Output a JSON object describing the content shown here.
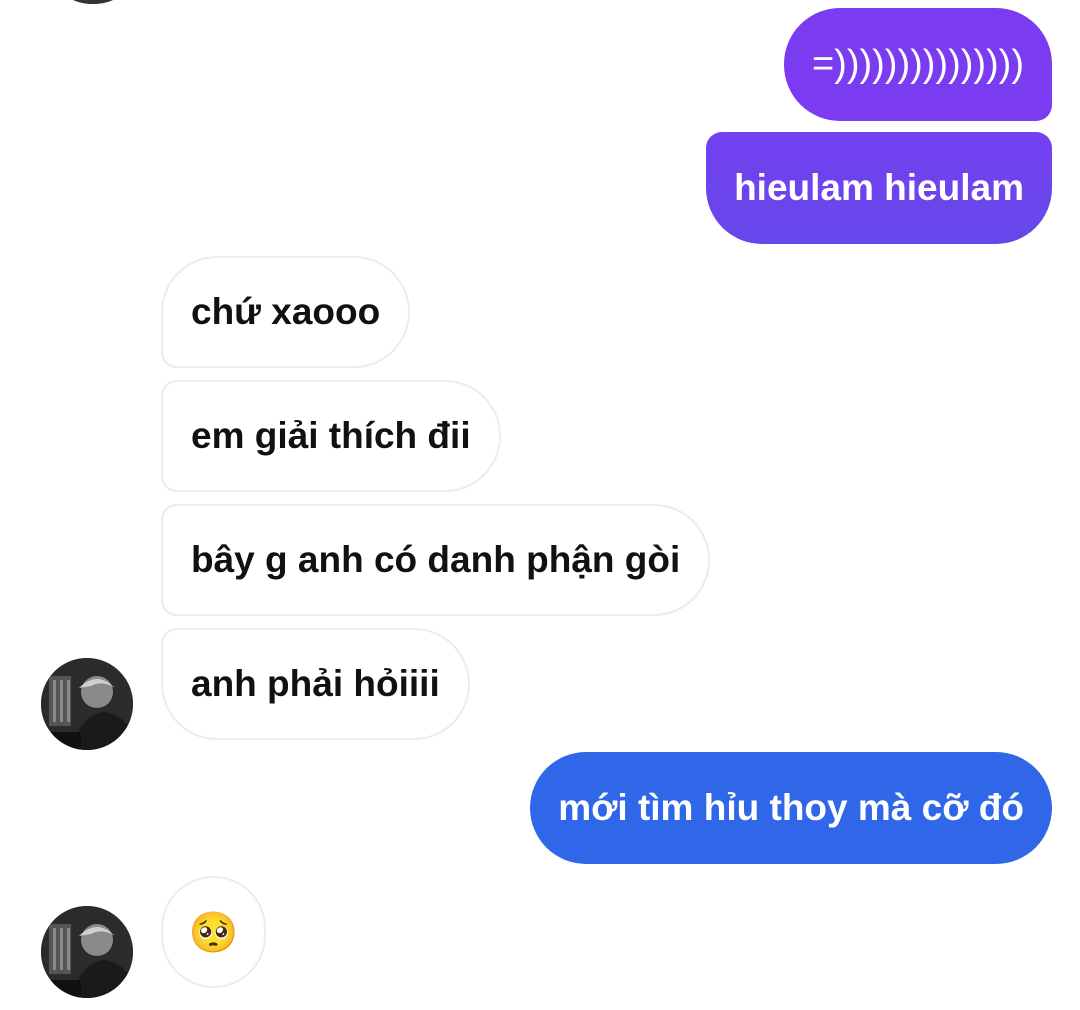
{
  "colors": {
    "outgoing_purple": "#7b3cf0",
    "outgoing_violet": "#6b45ec",
    "outgoing_blue": "#3066e8",
    "incoming_bg": "#ffffff",
    "incoming_border": "#ececec"
  },
  "messages": [
    {
      "sender": "me",
      "text": "=)))))))))))))))"
    },
    {
      "sender": "me",
      "text": "hieulam hieulam"
    },
    {
      "sender": "them",
      "text": "chứ xaooo"
    },
    {
      "sender": "them",
      "text": "em giải thích đii"
    },
    {
      "sender": "them",
      "text": "bây g anh có danh phận gòi"
    },
    {
      "sender": "them",
      "text": "anh phải hỏiiii"
    },
    {
      "sender": "me",
      "text": "mới tìm hỉu thoy mà cỡ đó"
    },
    {
      "sender": "them",
      "text": "🥺"
    }
  ],
  "avatar": {
    "icon": "contact-avatar"
  }
}
